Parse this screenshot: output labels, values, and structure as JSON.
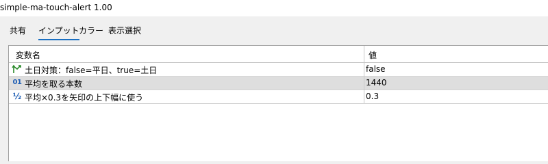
{
  "window": {
    "title": "simple-ma-touch-alert 1.00"
  },
  "tabs": [
    {
      "label": "共有",
      "active": false
    },
    {
      "label": "インプット",
      "active": true
    },
    {
      "label": "カラー",
      "active": false
    },
    {
      "label": "表示選択",
      "active": false
    }
  ],
  "table": {
    "headers": {
      "name": "変数名",
      "value": "値"
    },
    "rows": [
      {
        "icon": "bool-arrow-icon",
        "name": "土日対策：false=平日、true=土日",
        "value": "false",
        "selected": false
      },
      {
        "icon": "integer-icon",
        "name": "平均を取る本数",
        "value": "1440",
        "selected": true
      },
      {
        "icon": "double-icon",
        "name": "平均×0.3を矢印の上下幅に使う",
        "value": "0.3",
        "selected": false
      }
    ]
  },
  "icons": {
    "integer_glyph": "01",
    "double_glyph": "½"
  },
  "colors": {
    "tab_underline": "#1a6fc2",
    "selected_row": "#dedede",
    "bool_icon": "#2a8a2a",
    "numeric_icon": "#1f5fb5"
  }
}
